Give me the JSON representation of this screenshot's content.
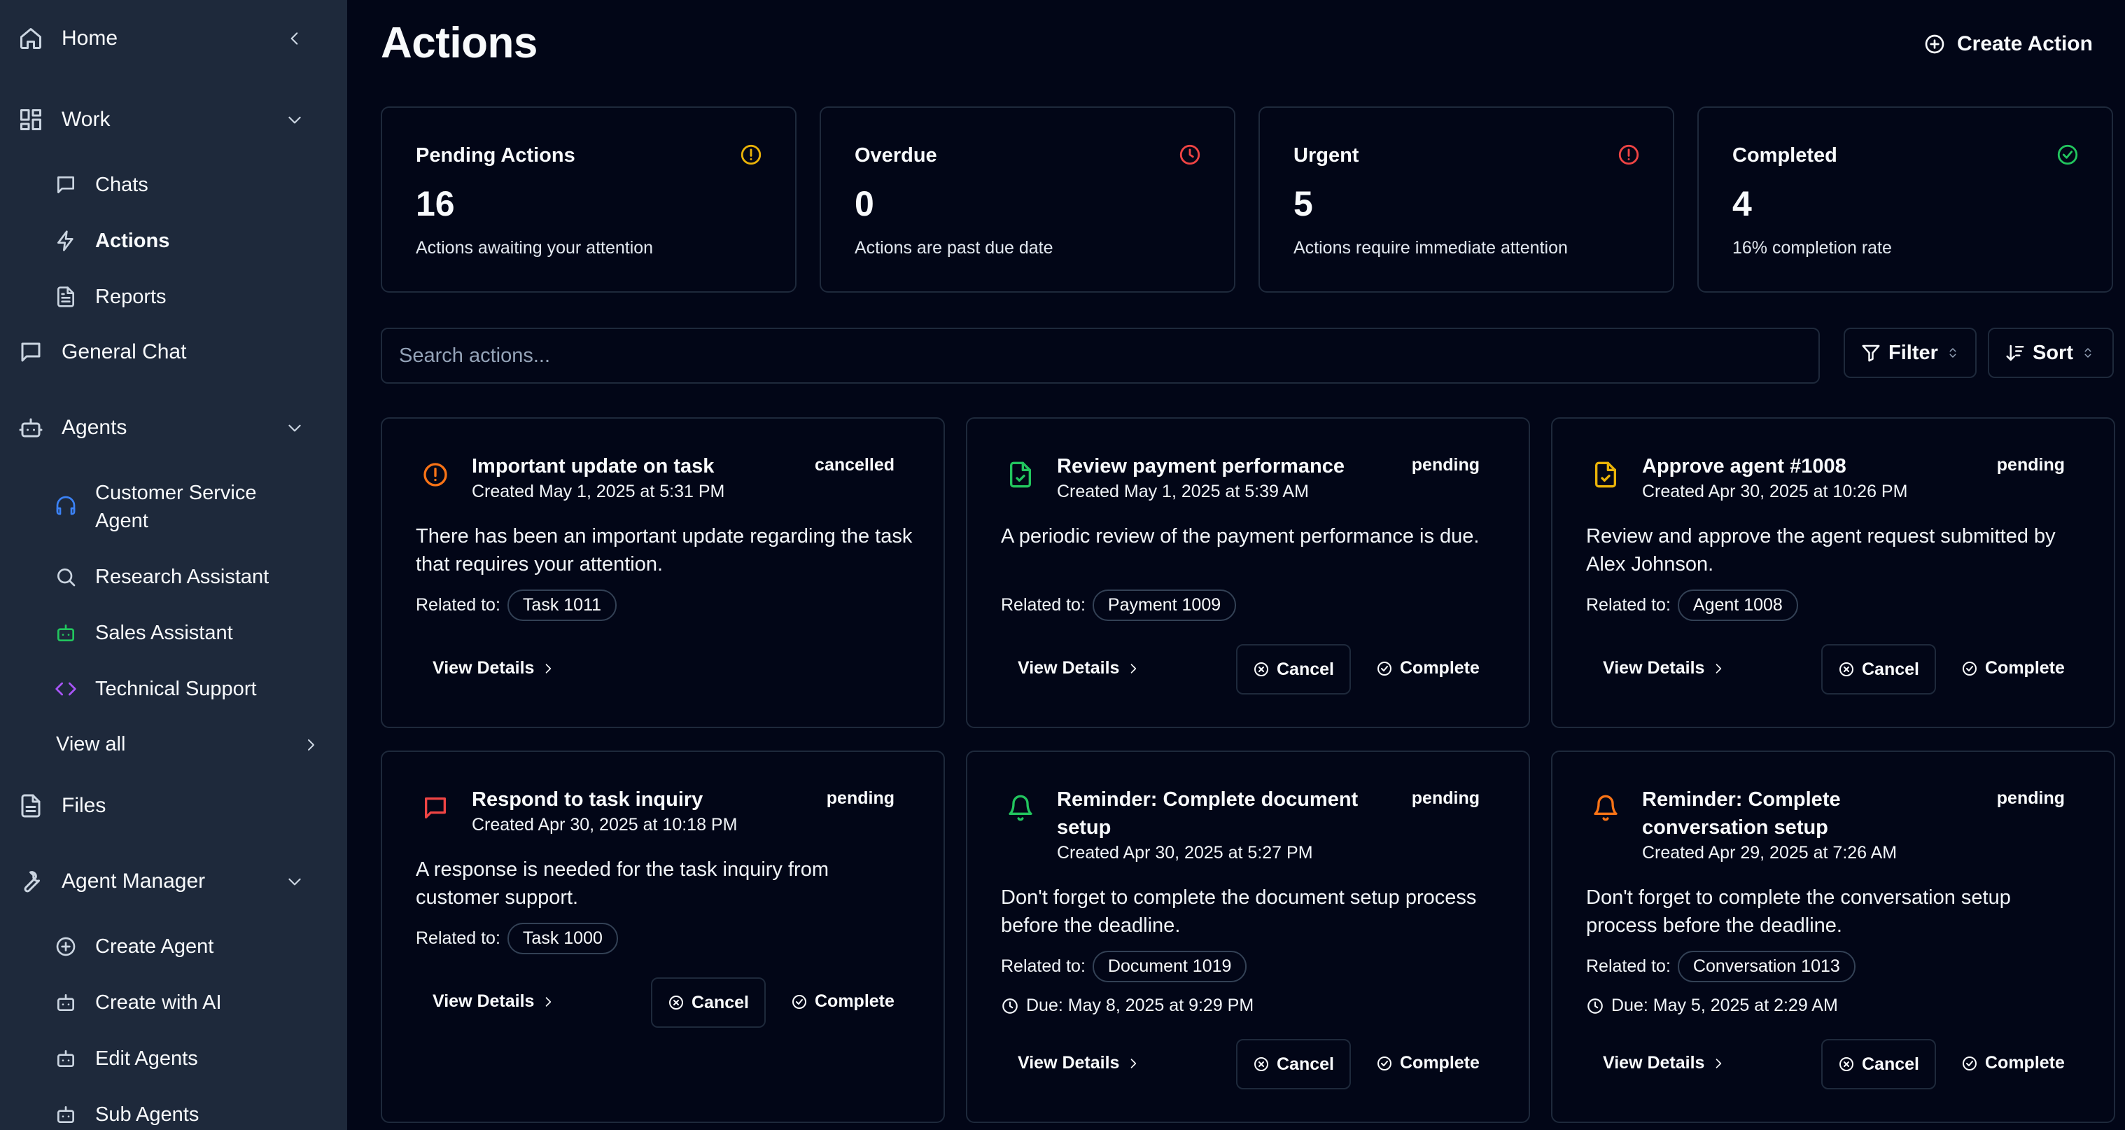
{
  "colors": {
    "amber": "#eab308",
    "red": "#ef4444",
    "green": "#22c55e",
    "orange": "#f97316",
    "blue": "#3b82f6",
    "purple": "#a855f7"
  },
  "sidebar": {
    "home": {
      "label": "Home",
      "icon": "home-icon"
    },
    "work": {
      "label": "Work",
      "icon": "grid-icon"
    },
    "work_items": [
      {
        "label": "Chats",
        "icon": "message-icon"
      },
      {
        "label": "Actions",
        "icon": "zap-icon"
      },
      {
        "label": "Reports",
        "icon": "file-text-icon"
      }
    ],
    "general_chat": {
      "label": "General Chat",
      "icon": "message-icon"
    },
    "agents": {
      "label": "Agents",
      "icon": "bot-icon"
    },
    "agent_items": [
      {
        "label": "Customer Service Agent",
        "icon": "headphones-icon"
      },
      {
        "label": "Research Assistant",
        "icon": "search-icon"
      },
      {
        "label": "Sales Assistant",
        "icon": "bot-icon"
      },
      {
        "label": "Technical Support",
        "icon": "code-icon"
      }
    ],
    "view_all": "View all",
    "files": {
      "label": "Files",
      "icon": "file-icon"
    },
    "agent_manager": {
      "label": "Agent Manager",
      "icon": "wrench-icon"
    },
    "manager_items": [
      {
        "label": "Create Agent",
        "icon": "plus-circle-icon"
      },
      {
        "label": "Create with AI",
        "icon": "bot-icon"
      },
      {
        "label": "Edit Agents",
        "icon": "bot-icon"
      },
      {
        "label": "Sub Agents",
        "icon": "bot-icon"
      }
    ]
  },
  "header": {
    "title": "Actions",
    "create_label": "Create Action"
  },
  "stats": [
    {
      "title": "Pending Actions",
      "value": "16",
      "desc": "Actions awaiting your attention",
      "icon": "alert-circle-icon"
    },
    {
      "title": "Overdue",
      "value": "0",
      "desc": "Actions are past due date",
      "icon": "clock-icon"
    },
    {
      "title": "Urgent",
      "value": "5",
      "desc": "Actions require immediate attention",
      "icon": "alert-circle-icon"
    },
    {
      "title": "Completed",
      "value": "4",
      "desc": "16% completion rate",
      "icon": "check-circle-icon"
    }
  ],
  "toolbar": {
    "search_placeholder": "Search actions...",
    "filter_label": "Filter",
    "sort_label": "Sort"
  },
  "card_labels": {
    "related_to": "Related to:",
    "view_details": "View Details",
    "cancel": "Cancel",
    "complete": "Complete"
  },
  "cards": [
    {
      "title": "Important update on task",
      "status": "cancelled",
      "created": "Created May 1, 2025 at 5:31 PM",
      "desc": "There has been an important update regarding the task that requires your attention.",
      "related": "Task 1011",
      "icon": "alert-circle-icon"
    },
    {
      "title": "Review payment performance",
      "status": "pending",
      "created": "Created May 1, 2025 at 5:39 AM",
      "desc": "A periodic review of the payment performance is due.",
      "related": "Payment 1009",
      "icon": "file-check-icon"
    },
    {
      "title": "Approve agent #1008",
      "status": "pending",
      "created": "Created Apr 30, 2025 at 10:26 PM",
      "desc": "Review and approve the agent request submitted by Alex Johnson.",
      "related": "Agent 1008",
      "icon": "file-check-icon"
    },
    {
      "title": "Respond to task inquiry",
      "status": "pending",
      "created": "Created Apr 30, 2025 at 10:18 PM",
      "desc": "A response is needed for the task inquiry from customer support.",
      "related": "Task 1000",
      "icon": "message-icon"
    },
    {
      "title": "Reminder: Complete document setup",
      "status": "pending",
      "created": "Created Apr 30, 2025 at 5:27 PM",
      "desc": "Don't forget to complete the document setup process before the deadline.",
      "related": "Document 1019",
      "due": "Due: May 8, 2025 at 9:29 PM",
      "icon": "bell-icon"
    },
    {
      "title": "Reminder: Complete conversation setup",
      "status": "pending",
      "created": "Created Apr 29, 2025 at 7:26 AM",
      "desc": "Don't forget to complete the conversation setup process before the deadline.",
      "related": "Conversation 1013",
      "due": "Due: May 5, 2025 at 2:29 AM",
      "icon": "bell-icon"
    }
  ]
}
